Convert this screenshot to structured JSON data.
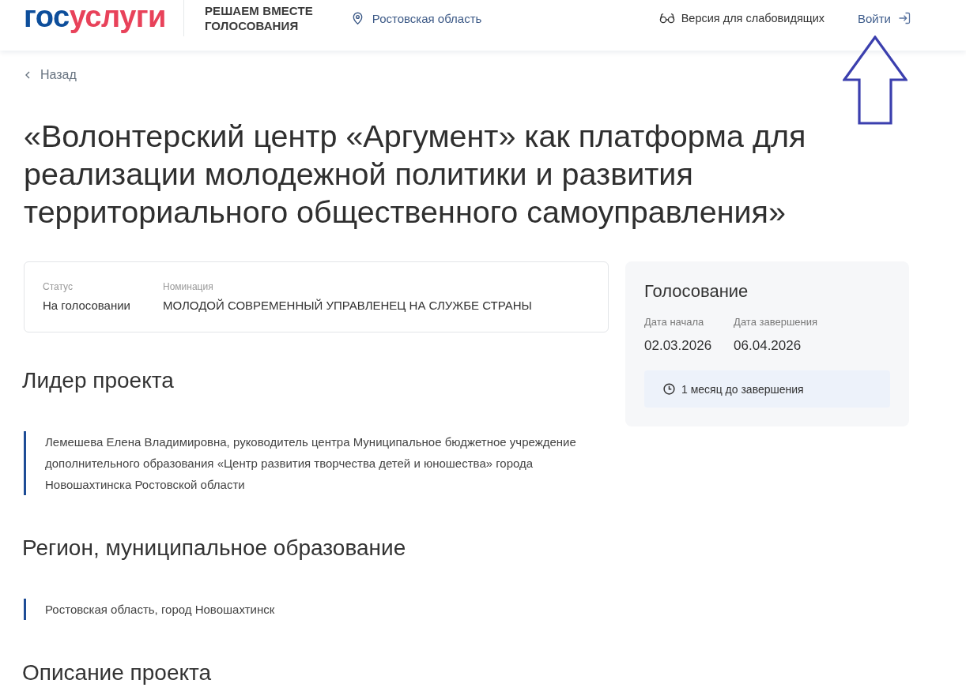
{
  "header": {
    "logo": [
      "гос",
      "услуги"
    ],
    "service_title": [
      "РЕШАЕМ ВМЕСТЕ",
      "ГОЛОСОВАНИЯ"
    ],
    "region": "Ростовская область",
    "accessibility": "Версия для слабовидящих",
    "login": "Войти"
  },
  "back": "Назад",
  "title": "«Волонтерский центр «Аргумент» как платформа для реализации молодежной политики и развития территориального общественного самоуправления»",
  "info": [
    {
      "label": "Статус",
      "value": "На голосовании"
    },
    {
      "label": "Номинация",
      "value": "МОЛОДОЙ СОВРЕМЕННЫЙ УПРАВЛЕНЕЦ НА СЛУЖБЕ СТРАНЫ"
    }
  ],
  "voting": {
    "title": "Голосование",
    "dates": [
      {
        "label": "Дата начала",
        "value": "02.03.2026"
      },
      {
        "label": "Дата завершения",
        "value": "06.04.2026"
      }
    ],
    "remaining": "1 месяц до завершения"
  },
  "sections": [
    {
      "heading": "Лидер проекта",
      "text": "Лемешева Елена Владимировна, руководитель центра Муниципальное бюджетное учреждение дополнительного образования «Центр развития творчества детей и юношества» города Новошахтинска Ростовской области"
    },
    {
      "heading": "Регион, муниципальное образование",
      "text": "Ростовская область, город Новошахтинск"
    },
    {
      "heading": "Описание проекта"
    }
  ],
  "annotation": {
    "kind": "arrow"
  }
}
